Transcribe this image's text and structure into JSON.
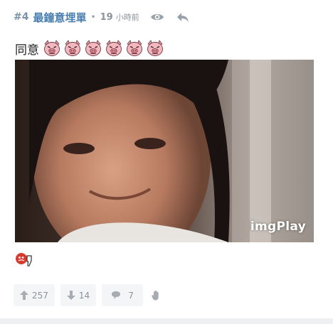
{
  "post": {
    "floor": "#4",
    "author": "最鐘意埋單",
    "separator": "•",
    "time_value": "19",
    "time_unit": "小時前",
    "text": "同意",
    "pig_emoji_count": 6,
    "gif_watermark": "imgPlay",
    "sticker_icon": "thumbs-down-sticker-icon"
  },
  "header_icons": [
    "eye-icon",
    "reply-icon"
  ],
  "actions": {
    "upvotes": "257",
    "downvotes": "14",
    "comments": "7"
  },
  "colors": {
    "author": "#4a7fb0",
    "muted": "#8b9299",
    "button_bg": "#f4f5f6"
  }
}
